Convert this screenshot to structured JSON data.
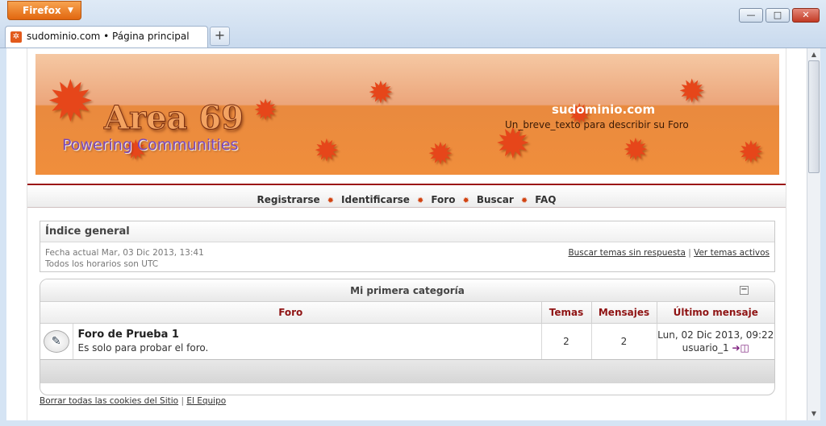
{
  "browser": {
    "menu_button": "Firefox",
    "tab_title": "sudominio.com • Página principal",
    "new_tab": "+",
    "controls": {
      "minimize": "—",
      "maximize": "□",
      "close": "✕"
    }
  },
  "header": {
    "logo_title": "Area 69",
    "logo_subtitle": "Powering Communities",
    "site_name": "sudominio.com",
    "site_description": "Un_breve_texto para describir su Foro"
  },
  "nav": {
    "items": [
      "Registrarse",
      "Identificarse",
      "Foro",
      "Buscar",
      "FAQ"
    ],
    "separator": "✹"
  },
  "index": {
    "title": "Índice general",
    "current_date": "Fecha actual Mar, 03 Dic 2013, 13:41",
    "timezone": "Todos los horarios son UTC",
    "link_unanswered": "Buscar temas sin respuesta",
    "link_separator": "|",
    "link_active": "Ver temas activos"
  },
  "category": {
    "title": "Mi primera categoría",
    "collapse_icon": "−",
    "columns": {
      "forum": "Foro",
      "topics": "Temas",
      "posts": "Mensajes",
      "last": "Último mensaje"
    },
    "forums": [
      {
        "name": "Foro de Prueba 1",
        "description": "Es solo para probar el foro.",
        "topics": "2",
        "posts": "2",
        "last_date": "Lun, 02 Dic 2013, 09:22",
        "last_user": "usuario_1",
        "icon": "forum-read-icon"
      }
    ]
  },
  "footer": {
    "delete_cookies": "Borrar todas las cookies del Sitio",
    "separator": "|",
    "team": "El Equipo"
  },
  "colors": {
    "accent": "#e98a3e",
    "header_red": "#8f1414",
    "nav_border": "#9b1616"
  }
}
